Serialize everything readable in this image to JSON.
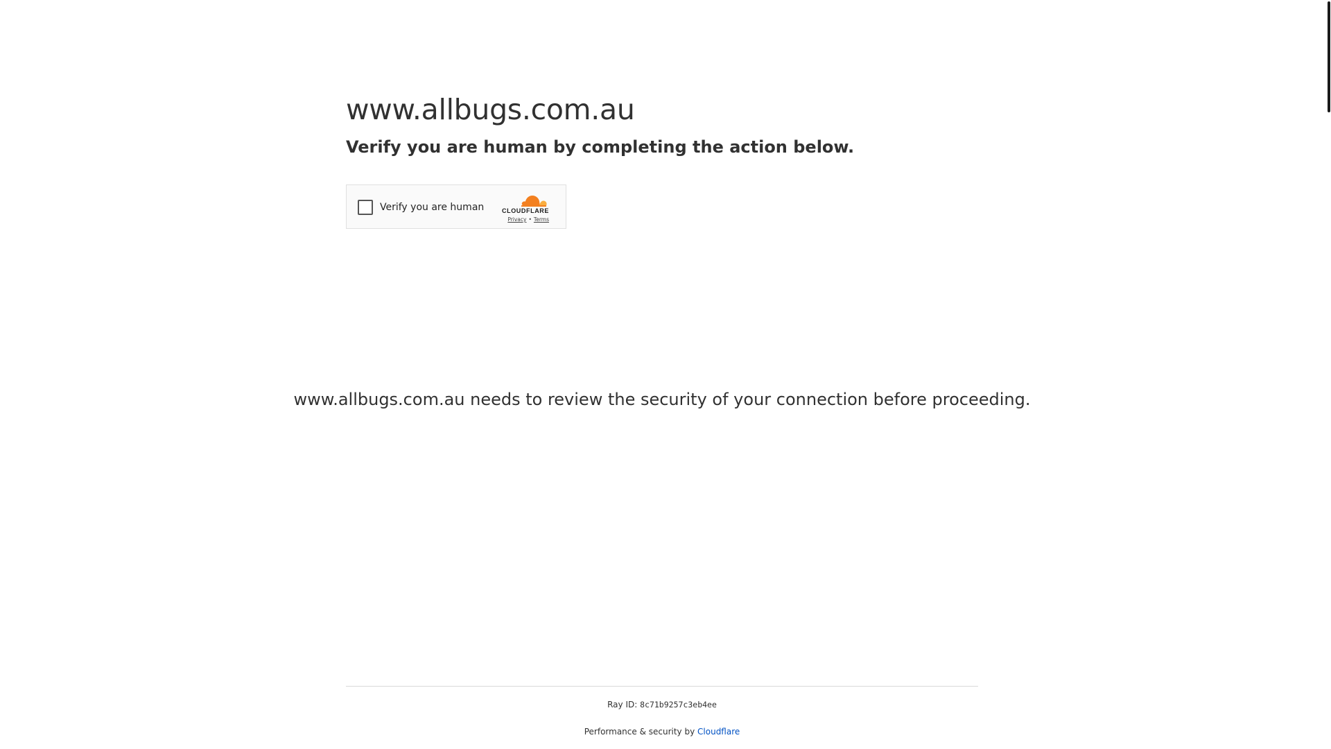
{
  "header": {
    "site_title": "www.allbugs.com.au",
    "subtitle": "Verify you are human by completing the action below."
  },
  "widget": {
    "checkbox_label": "Verify you are human",
    "brand": "CLOUDFLARE",
    "privacy_link": "Privacy",
    "separator": "•",
    "terms_link": "Terms"
  },
  "body": {
    "review_text": "www.allbugs.com.au needs to review the security of your connection before proceeding."
  },
  "footer": {
    "ray_label": "Ray ID:",
    "ray_id": "8c71b9257c3eb4ee",
    "performance_text": "Performance & security by",
    "cloudflare_link": "Cloudflare"
  },
  "colors": {
    "text": "#313131",
    "link": "#0051c3",
    "cloud_orange": "#f38020",
    "cloud_light": "#faae40"
  },
  "icons": {
    "cloud": "cloudflare-cloud-icon",
    "checkbox": "checkbox-icon"
  }
}
